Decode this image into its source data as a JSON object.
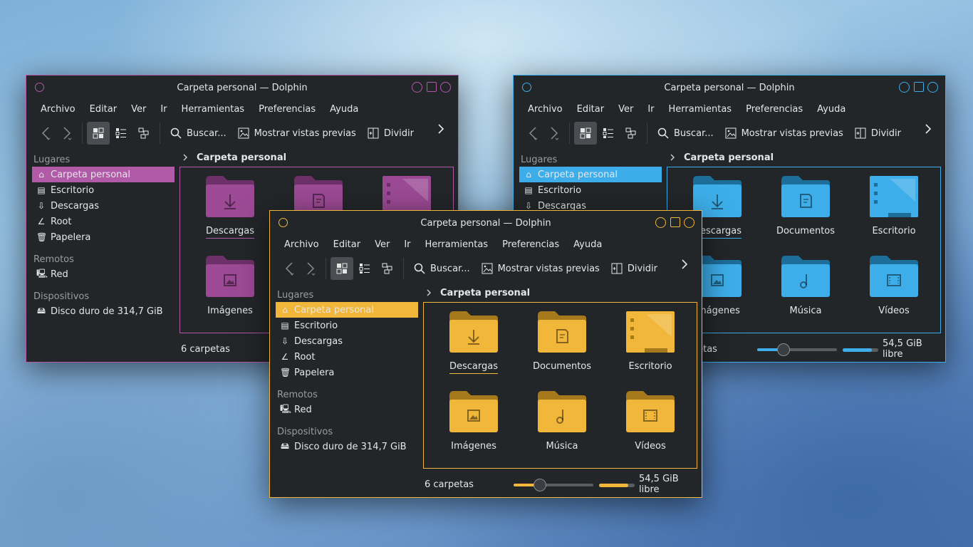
{
  "windows": [
    {
      "id": "purple",
      "accent": "#b05aa8",
      "folder_color": "#9c4a95",
      "folder_tab": "#6e3068",
      "title": "Carpeta personal — Dolphin"
    },
    {
      "id": "blue",
      "accent": "#3daee9",
      "folder_color": "#3daee9",
      "folder_tab": "#1d6e9a",
      "title": "Carpeta personal — Dolphin"
    },
    {
      "id": "yellow",
      "accent": "#f0b73a",
      "folder_color": "#f0b73a",
      "folder_tab": "#a67a1c",
      "title": "Carpeta personal — Dolphin"
    }
  ],
  "menu": [
    "Archivo",
    "Editar",
    "Ver",
    "Ir",
    "Herramientas",
    "Preferencias",
    "Ayuda"
  ],
  "toolbar": {
    "search_label": "Buscar...",
    "previews_label": "Mostrar vistas previas",
    "split_label": "Dividir"
  },
  "places": {
    "lugares_heading": "Lugares",
    "lugares": [
      {
        "label": "Carpeta personal",
        "icon": "home-icon"
      },
      {
        "label": "Escritorio",
        "icon": "desktop-icon"
      },
      {
        "label": "Descargas",
        "icon": "download-icon"
      },
      {
        "label": "Root",
        "icon": "root-icon"
      },
      {
        "label": "Papelera",
        "icon": "trash-icon"
      }
    ],
    "remotos_heading": "Remotos",
    "remotos": [
      {
        "label": "Red",
        "icon": "network-icon"
      }
    ],
    "dispositivos_heading": "Dispositivos",
    "dispositivos": [
      {
        "label": "Disco duro de 314,7 GiB",
        "icon": "harddisk-icon"
      }
    ]
  },
  "breadcrumb": "Carpeta personal",
  "folders": [
    {
      "label": "Descargas",
      "icon": "download-folder-icon"
    },
    {
      "label": "Documentos",
      "icon": "documents-folder-icon"
    },
    {
      "label": "Escritorio",
      "icon": "desktop-folder-icon"
    },
    {
      "label": "Imágenes",
      "icon": "pictures-folder-icon"
    },
    {
      "label": "Música",
      "icon": "music-folder-icon"
    },
    {
      "label": "Vídeos",
      "icon": "videos-folder-icon"
    }
  ],
  "status": {
    "count": "6 carpetas",
    "free": "54,5 GiB libre",
    "zoom_level": 0.33,
    "space_used_fraction": 0.82
  }
}
